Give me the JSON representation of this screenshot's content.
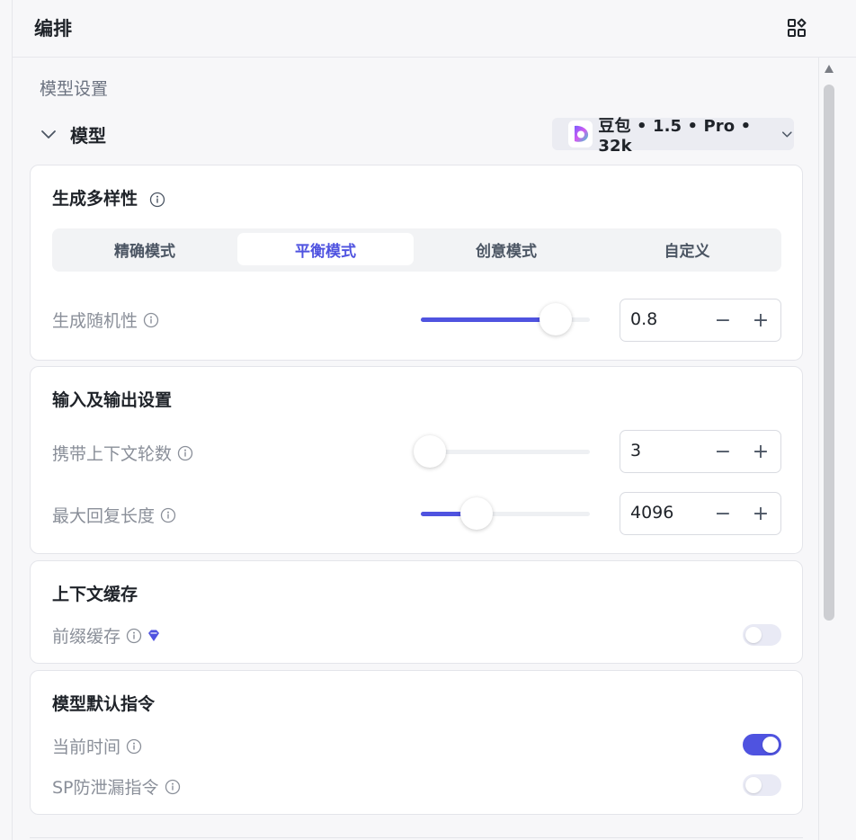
{
  "header": {
    "title": "编排",
    "layout_icon": "layout-grid-icon"
  },
  "model_settings": {
    "section_label": "模型设置",
    "model_row_label": "模型",
    "selected_model": "豆包 • 1.5 • Pro • 32k",
    "model_icon": "doubao-logo-icon"
  },
  "diversity": {
    "title": "生成多样性",
    "modes": [
      "精确模式",
      "平衡模式",
      "创意模式",
      "自定义"
    ],
    "active_mode": "平衡模式",
    "randomness": {
      "label": "生成随机性",
      "value": "0.8",
      "slider_fraction": 0.8
    }
  },
  "io_settings": {
    "title": "输入及输出设置",
    "context_rounds": {
      "label": "携带上下文轮数",
      "value": "3",
      "slider_fraction": 0.0
    },
    "max_reply_length": {
      "label": "最大回复长度",
      "value": "4096",
      "slider_fraction": 0.33
    }
  },
  "context_cache": {
    "title": "上下文缓存",
    "prefix_cache": {
      "label": "前缀缓存",
      "premium_icon": "diamond-icon",
      "enabled": false
    }
  },
  "default_instructions": {
    "title": "模型默认指令",
    "current_time": {
      "label": "当前时间",
      "enabled": true
    },
    "sp_leak_guard": {
      "label": "SP防泄漏指令",
      "enabled": false
    }
  },
  "colors": {
    "accent": "#4f53e0",
    "toggle_off": "#e9eaf5",
    "muted_text": "#8a8f99"
  }
}
